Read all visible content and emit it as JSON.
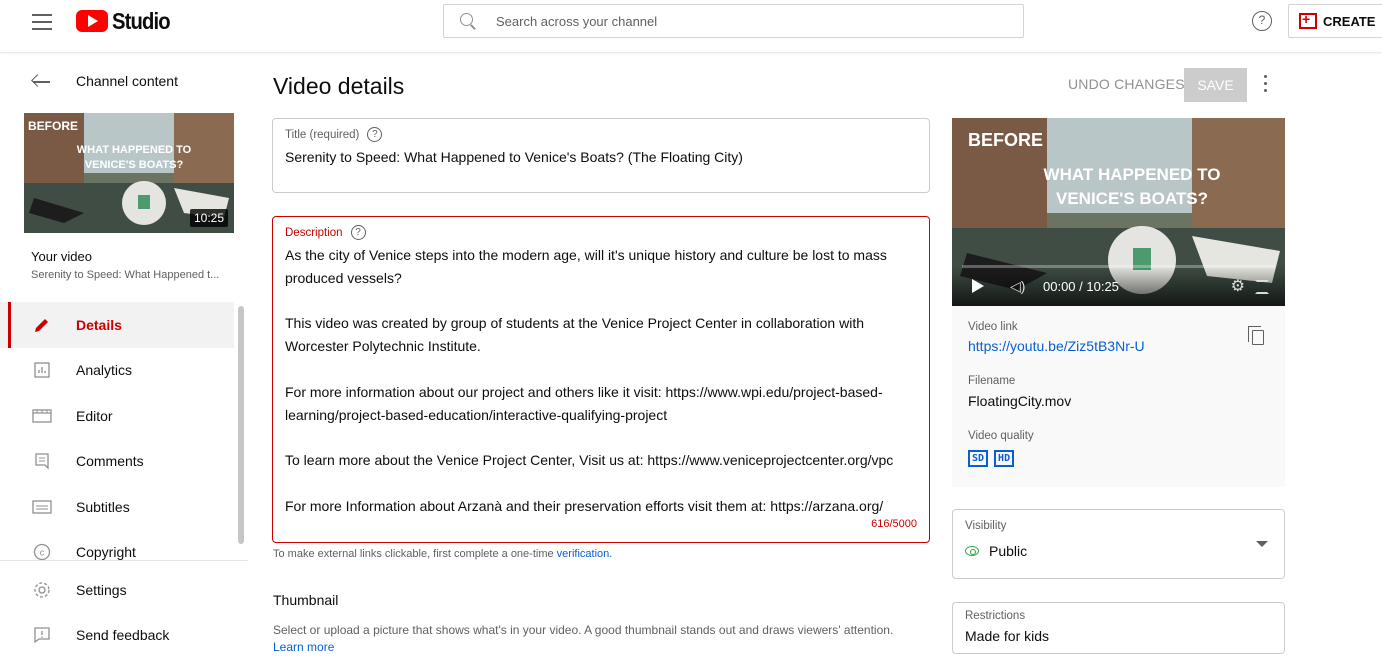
{
  "header": {
    "logo_text": "Studio",
    "search_placeholder": "Search across your channel",
    "help_glyph": "?",
    "create_label": "CREATE"
  },
  "sidebar": {
    "back_label": "Channel content",
    "thumbnail": {
      "duration": "10:25",
      "overlay_before": "BEFORE",
      "overlay_line1": "WHAT HAPPENED TO",
      "overlay_line2": "VENICE'S BOATS?"
    },
    "your_video_label": "Your video",
    "your_video_title": "Serenity to Speed: What Happened t...",
    "nav_items": [
      {
        "label": "Details",
        "icon": "pencil-icon",
        "active": true
      },
      {
        "label": "Analytics",
        "icon": "analytics-icon"
      },
      {
        "label": "Editor",
        "icon": "editor-icon"
      },
      {
        "label": "Comments",
        "icon": "comments-icon"
      },
      {
        "label": "Subtitles",
        "icon": "subtitles-icon"
      },
      {
        "label": "Copyright",
        "icon": "copyright-icon"
      }
    ],
    "bottom_items": [
      {
        "label": "Settings",
        "icon": "gear-icon"
      },
      {
        "label": "Send feedback",
        "icon": "feedback-icon"
      }
    ]
  },
  "main": {
    "page_title": "Video details",
    "undo_label": "UNDO CHANGES",
    "save_label": "SAVE",
    "title_field": {
      "label": "Title (required)",
      "value": "Serenity to Speed: What Happened to Venice's Boats? (The Floating City)"
    },
    "description_field": {
      "label": "Description",
      "paragraphs": [
        "As the city of Venice steps into the modern age, will it's unique history and culture be lost to mass produced vessels?",
        "This video was created by group of students at the Venice Project Center in collaboration with Worcester Polytechnic Institute.",
        "For more information about our project and others like it visit: https://www.wpi.edu/project-based-learning/project-based-education/interactive-qualifying-project",
        "To learn more about the Venice Project Center, Visit us at: https://www.veniceprojectcenter.org/vpc",
        "For more Information about Arzanà and their preservation efforts visit them at: https://arzana.org/"
      ],
      "counter": "616/5000"
    },
    "link_note_text": "To make external links clickable, first complete a one-time ",
    "link_note_link": "verification.",
    "thumbnail_heading": "Thumbnail",
    "thumbnail_desc": "Select or upload a picture that shows what's in your video. A good thumbnail stands out and draws viewers' attention.",
    "learn_more": "Learn more"
  },
  "preview": {
    "time": "00:00 / 10:25",
    "video_link_label": "Video link",
    "video_link": "https://youtu.be/Ziz5tB3Nr-U",
    "filename_label": "Filename",
    "filename": "FloatingCity.mov",
    "quality_label": "Video quality",
    "quality_badges": [
      "SD",
      "HD"
    ]
  },
  "visibility": {
    "label": "Visibility",
    "value": "Public"
  },
  "restrictions": {
    "label": "Restrictions",
    "value": "Made for kids"
  },
  "colors": {
    "accent": "#cc0000",
    "link": "#065fd4",
    "public_green": "#2ba640"
  }
}
